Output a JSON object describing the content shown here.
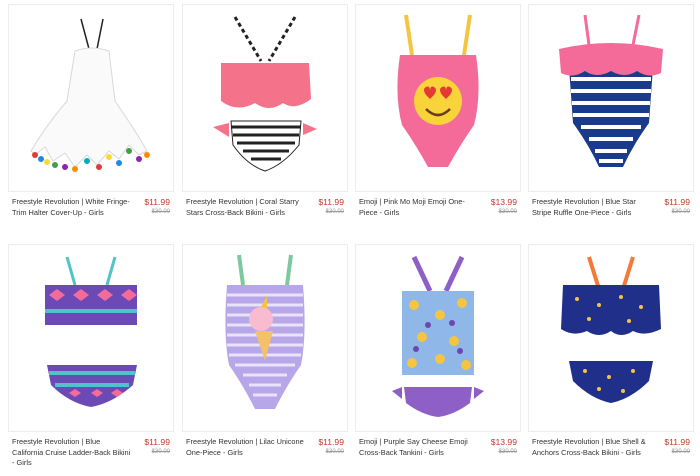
{
  "products": [
    {
      "title": "Freestyle Revolution | White Fringe-Trim Halter Cover-Up - Girls",
      "price": "$11.99",
      "old_price": "$30.00",
      "image": "white-fringe-coverup"
    },
    {
      "title": "Freestyle Revolution | Coral Starry Stars Cross-Back Bikini - Girls",
      "price": "$11.99",
      "old_price": "$30.00",
      "image": "coral-stars-bikini"
    },
    {
      "title": "Emoji | Pink Mo Moji Emoji One-Piece - Girls",
      "price": "$13.99",
      "old_price": "$30.00",
      "image": "pink-emoji-onepiece"
    },
    {
      "title": "Freestyle Revolution | Blue Star Stripe Ruffle One-Piece - Girls",
      "price": "$11.99",
      "old_price": "$30.00",
      "image": "blue-stripe-ruffle-onepiece"
    },
    {
      "title": "Freestyle Revolution | Blue California Cruise Ladder-Back Bikini - Girls",
      "price": "$11.99",
      "old_price": "$30.00",
      "image": "tribal-print-bikini"
    },
    {
      "title": "Freestyle Revolution | Lilac Unicone One-Piece - Girls",
      "price": "$11.99",
      "old_price": "$30.00",
      "image": "lilac-unicone-onepiece"
    },
    {
      "title": "Emoji | Purple Say Cheese Emoji Cross-Back Tankini - Girls",
      "price": "$13.99",
      "old_price": "$30.00",
      "image": "purple-emoji-tankini"
    },
    {
      "title": "Freestyle Revolution | Blue Shell & Anchors Cross-Back Bikini - Girls",
      "price": "$11.99",
      "old_price": "$30.00",
      "image": "navy-anchors-bikini"
    }
  ],
  "colors": {
    "price": "#c0392b",
    "old_price": "#999999",
    "title": "#333333"
  }
}
